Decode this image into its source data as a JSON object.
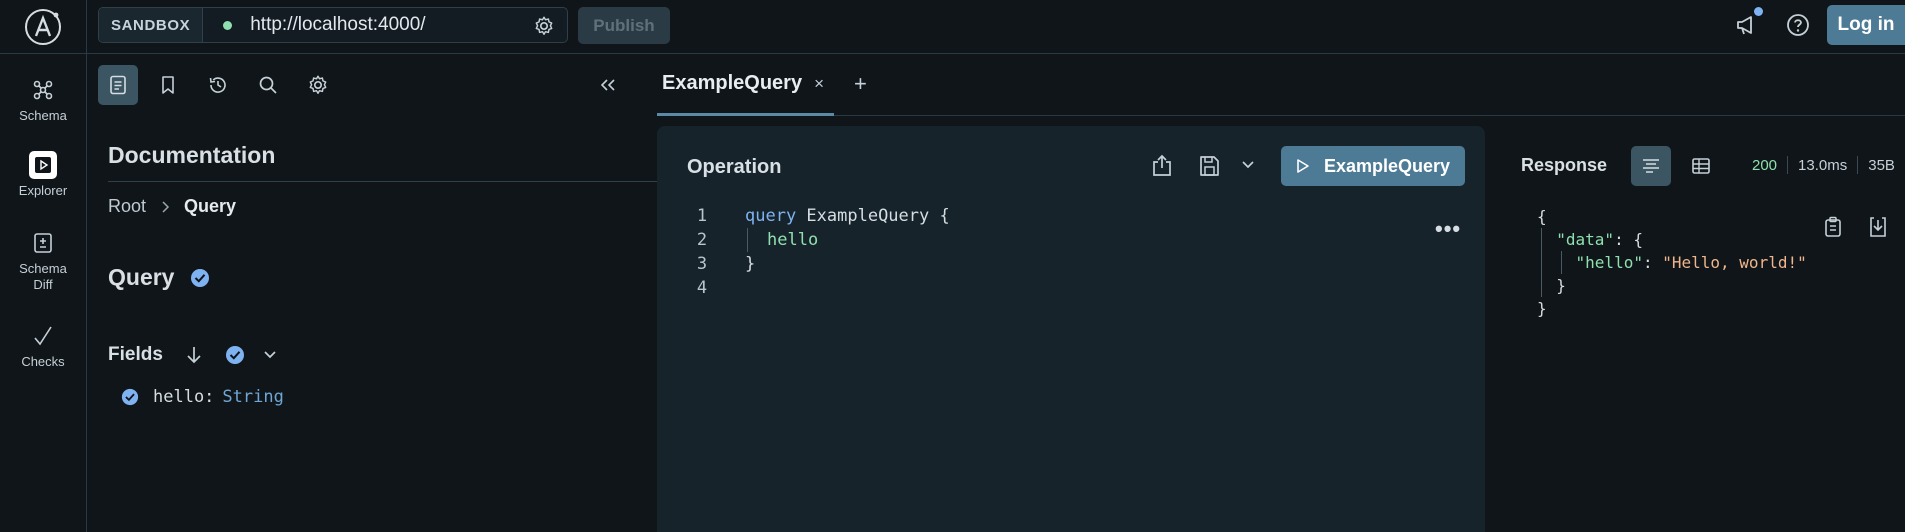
{
  "colors": {
    "background": "#0f1519",
    "panel": "#17232a",
    "accent": "#4d7a95",
    "active_toggle": "#3c5563",
    "status_dot": "#8fe0ae",
    "keyword": "#7fb2f0",
    "string": "#f0b58a"
  },
  "header": {
    "sandbox_label": "SANDBOX",
    "url_value": "http://localhost:4000/",
    "publish_label": "Publish",
    "login_label": "Log in",
    "icons": [
      "apollo-logo-icon",
      "gear-icon",
      "megaphone-icon",
      "help-icon"
    ]
  },
  "rail": {
    "items": [
      {
        "label": "Schema",
        "icon": "schema-graph-icon"
      },
      {
        "label": "Explorer",
        "icon": "explorer-play-icon"
      },
      {
        "label": "Schema\nDiff",
        "icon": "schema-diff-icon"
      },
      {
        "label": "Checks",
        "icon": "checkmark-icon"
      }
    ]
  },
  "docs": {
    "toolbar_icons": [
      "document-icon",
      "bookmark-icon",
      "history-icon",
      "search-icon",
      "settings-icon",
      "collapse-icon"
    ],
    "title": "Documentation",
    "breadcrumb": {
      "root": "Root",
      "current": "Query"
    },
    "type_name": "Query",
    "fields_label": "Fields",
    "fields": [
      {
        "name": "hello:",
        "type": "String"
      }
    ]
  },
  "tabs": [
    {
      "label": "ExampleQuery",
      "close": "×"
    }
  ],
  "tab_add": "+",
  "operation": {
    "title": "Operation",
    "run_label": "ExampleQuery",
    "more_label": "•••",
    "lines": [
      {
        "n": "1",
        "kw": "query",
        "rest": " ExampleQuery {"
      },
      {
        "n": "2",
        "field": "hello"
      },
      {
        "n": "3",
        "rest": "}"
      },
      {
        "n": "4",
        "rest": ""
      }
    ]
  },
  "response": {
    "title": "Response",
    "status": "200",
    "time": "13.0ms",
    "size": "35B",
    "json": {
      "open": "{",
      "data_key": "\"data\"",
      "colon_open": ": {",
      "hello_key": "\"hello\"",
      "colon": ": ",
      "hello_value": "\"Hello, world!\"",
      "inner_close": "}",
      "close": "}"
    }
  }
}
